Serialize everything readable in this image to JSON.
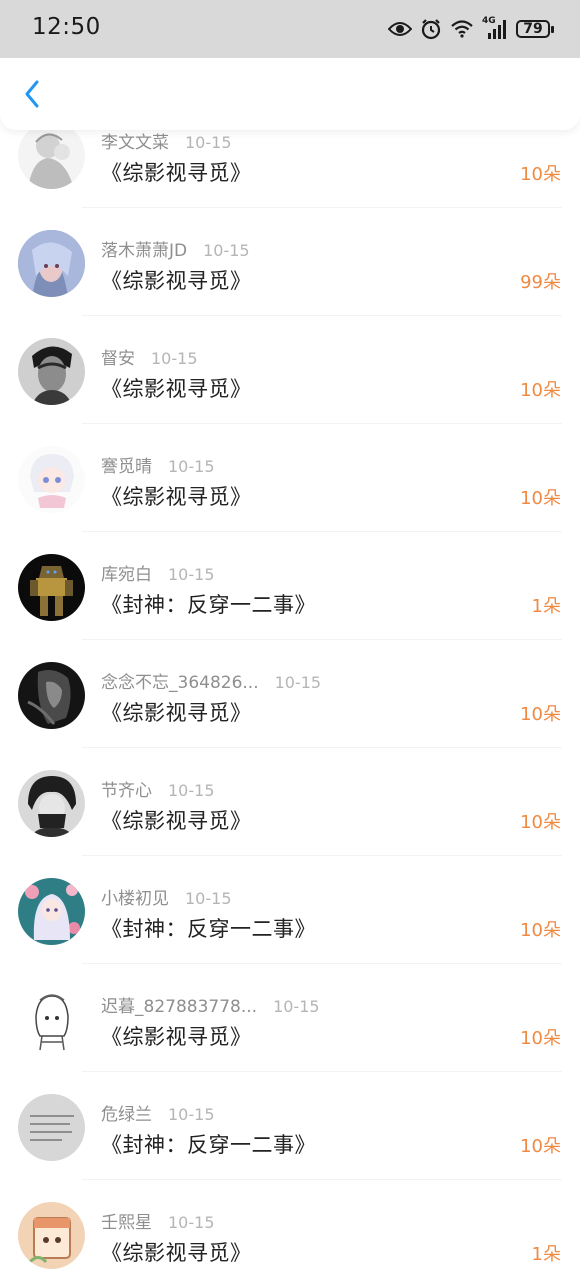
{
  "status_bar": {
    "time": "12:50",
    "network": "4G",
    "battery": "79",
    "icons": [
      "eye-icon",
      "alarm-icon",
      "wifi-icon",
      "signal-icon",
      "battery-icon"
    ]
  },
  "header": {
    "back_icon": "chevron-left-icon",
    "accent_color": "#2196f3"
  },
  "colors": {
    "amount": "#f08a43",
    "name": "#8f8f8f",
    "date": "#b5b5b5",
    "title": "#222222"
  },
  "items": [
    {
      "user": "李文文菜",
      "date": "10-15",
      "title": "《综影视寻觅》",
      "amount": "10朵",
      "avatar": "sketch-portrait"
    },
    {
      "user": "落木萧萧JD",
      "date": "10-15",
      "title": "《综影视寻觅》",
      "amount": "99朵",
      "avatar": "anime-blue-hair"
    },
    {
      "user": "督安",
      "date": "10-15",
      "title": "《综影视寻觅》",
      "amount": "10朵",
      "avatar": "monochrome-man"
    },
    {
      "user": "謇觅晴",
      "date": "10-15",
      "title": "《综影视寻觅》",
      "amount": "10朵",
      "avatar": "chibi-white-hair"
    },
    {
      "user": "库宛白",
      "date": "10-15",
      "title": "《封神：反穿一二事》",
      "amount": "1朵",
      "avatar": "robot"
    },
    {
      "user": "念念不忘_364826...",
      "date": "10-15",
      "title": "《综影视寻觅》",
      "amount": "10朵",
      "avatar": "dark-figure"
    },
    {
      "user": "节齐心",
      "date": "10-15",
      "title": "《综影视寻觅》",
      "amount": "10朵",
      "avatar": "dark-hair-boy"
    },
    {
      "user": "小楼初见",
      "date": "10-15",
      "title": "《封神：反穿一二事》",
      "amount": "10朵",
      "avatar": "anime-flowers"
    },
    {
      "user": "迟暮_827883778...",
      "date": "10-15",
      "title": "《综影视寻觅》",
      "amount": "10朵",
      "avatar": "line-drawing-girl"
    },
    {
      "user": "危绿兰",
      "date": "10-15",
      "title": "《封神：反穿一二事》",
      "amount": "10朵",
      "avatar": "text-card"
    },
    {
      "user": "壬熙星",
      "date": "10-15",
      "title": "《综影视寻觅》",
      "amount": "1朵",
      "avatar": "cartoon-box"
    }
  ]
}
